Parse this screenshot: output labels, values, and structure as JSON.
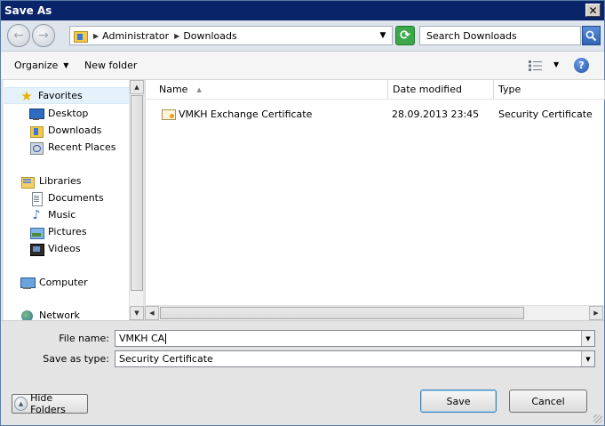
{
  "window": {
    "title": "Save As",
    "close_glyph": "✕"
  },
  "navigation": {
    "breadcrumb": [
      "Administrator",
      "Downloads"
    ],
    "search_placeholder": "Search Downloads"
  },
  "toolbar": {
    "organize_label": "Organize",
    "new_folder_label": "New folder",
    "help_glyph": "?"
  },
  "sidebar": {
    "items": [
      {
        "label": "Favorites",
        "icon": "star-icon"
      },
      {
        "label": "Desktop",
        "icon": "desktop-icon"
      },
      {
        "label": "Downloads",
        "icon": "downloads-folder-icon"
      },
      {
        "label": "Recent Places",
        "icon": "recent-places-icon"
      },
      {
        "label": "Libraries",
        "icon": "libraries-icon"
      },
      {
        "label": "Documents",
        "icon": "documents-icon"
      },
      {
        "label": "Music",
        "icon": "music-icon"
      },
      {
        "label": "Pictures",
        "icon": "pictures-icon"
      },
      {
        "label": "Videos",
        "icon": "videos-icon"
      },
      {
        "label": "Computer",
        "icon": "computer-icon"
      },
      {
        "label": "Network",
        "icon": "network-icon"
      }
    ],
    "selected": "Favorites"
  },
  "file_list": {
    "columns": [
      "Name",
      "Date modified",
      "Type"
    ],
    "rows": [
      {
        "name": "VMKH Exchange Certificate",
        "date": "28.09.2013 23:45",
        "type": "Security Certificate"
      }
    ]
  },
  "form": {
    "file_name_label": "File name:",
    "file_name_value": "VMKH CA",
    "save_type_label": "Save as type:",
    "save_type_value": "Security Certificate"
  },
  "buttons": {
    "hide_folders": "Hide Folders",
    "save": "Save",
    "cancel": "Cancel"
  },
  "colors": {
    "title_bar": "#0a246a",
    "accent_refresh": "#3da84a",
    "selection": "#e5f1fb"
  }
}
